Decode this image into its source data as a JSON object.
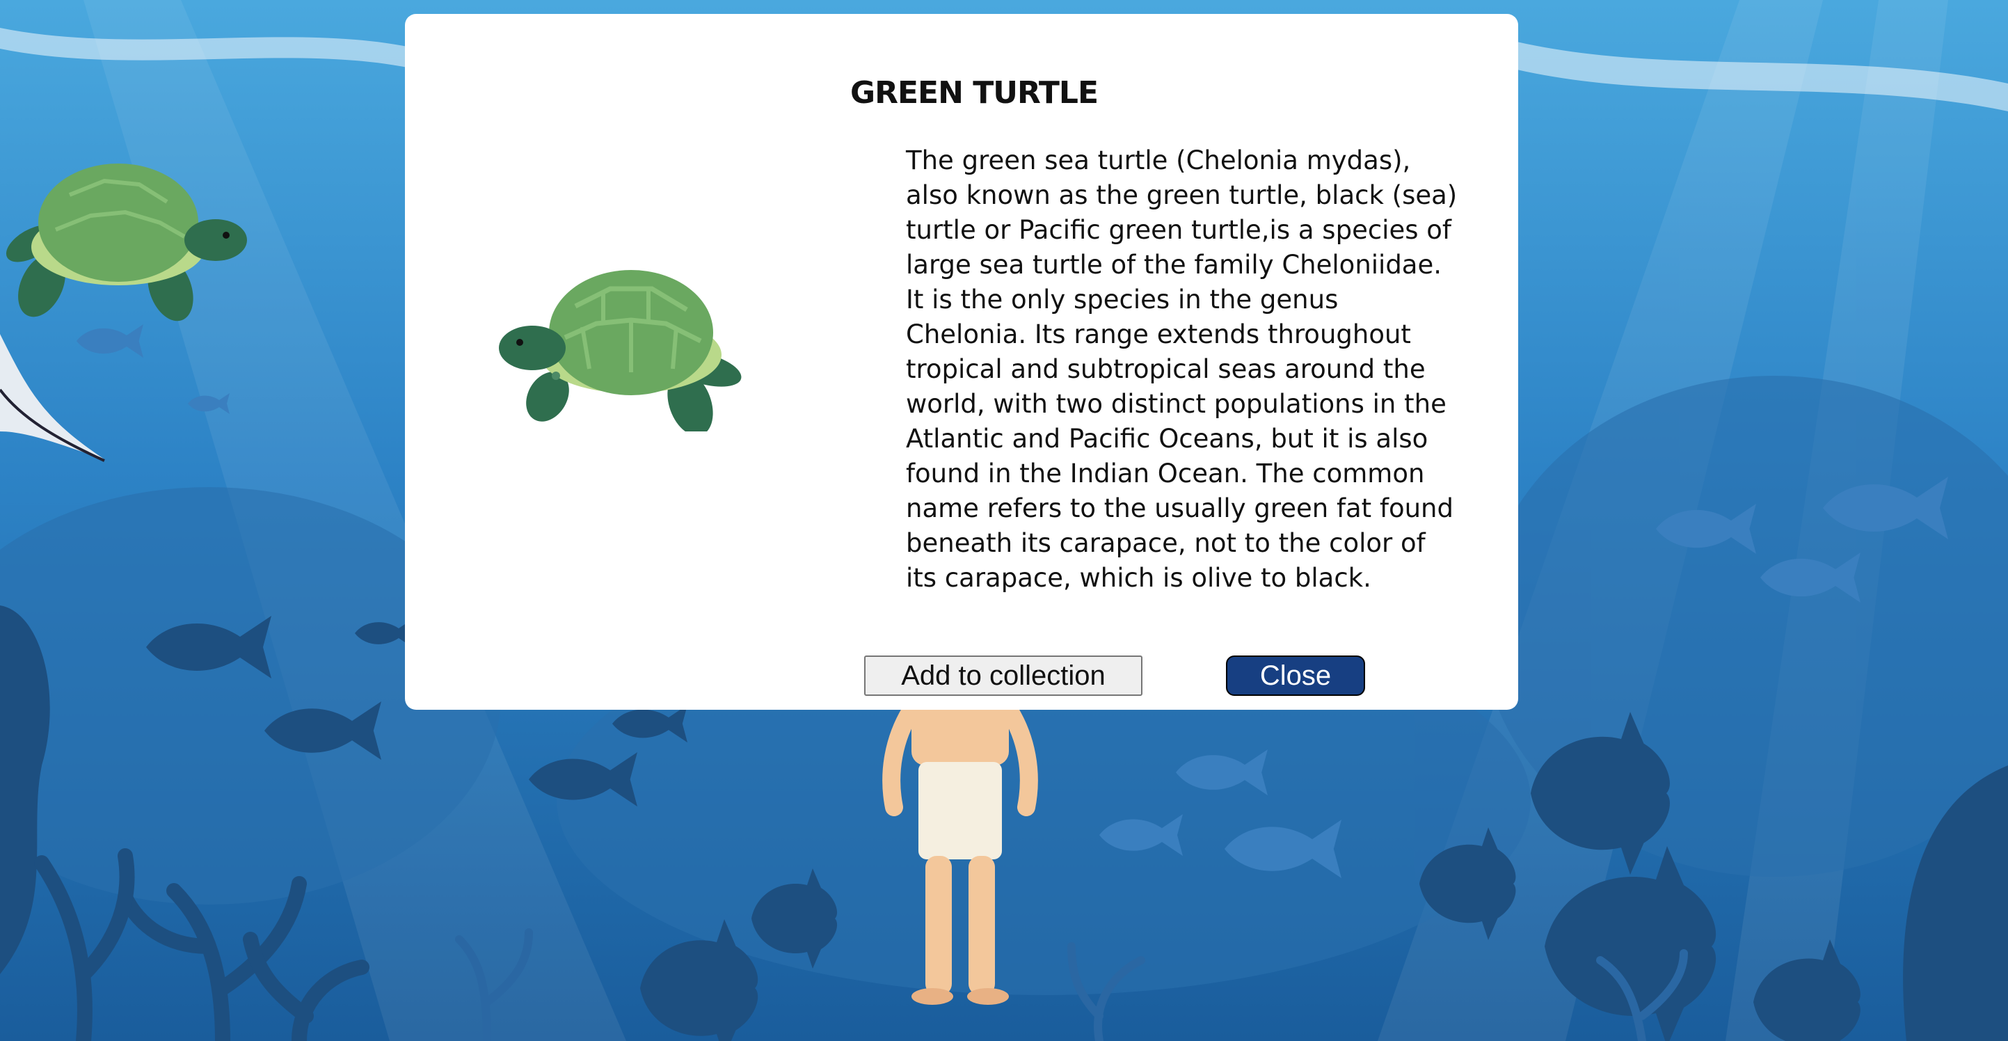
{
  "modal": {
    "title": "GREEN TURTLE",
    "description": "The green sea turtle (Chelonia mydas), also known as the green turtle, black (sea) turtle or Pacific green turtle,is a species of large sea turtle of the family Cheloniidae. It is the only species in the genus Chelonia. Its range extends throughout tropical and subtropical seas around the world, with two distinct populations in the Atlantic and Pacific Oceans, but it is also found in the Indian Ocean. The common name refers to the usually green fat found beneath its carapace, not to the color of its carapace, which is olive to black.",
    "image_icon": "green-turtle",
    "add_button_label": "Add to collection",
    "close_button_label": "Close"
  },
  "colors": {
    "ocean_top": "#49a6dc",
    "ocean_bottom": "#1a5d9c",
    "silhouette": "#1d4f80",
    "shell": "#6aa860",
    "skin": "#2f6e4e",
    "close_button": "#173f82"
  }
}
